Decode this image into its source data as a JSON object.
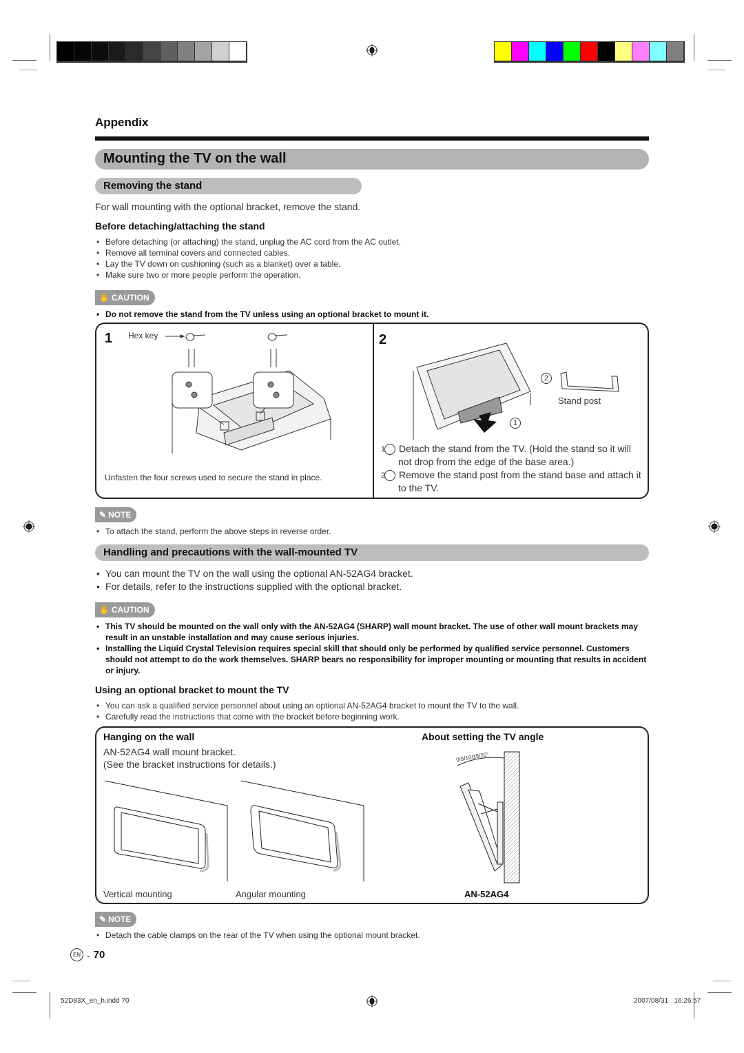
{
  "print_marks": {
    "grayscale_swatches": [
      "#000000",
      "#060606",
      "#0d0d0d",
      "#1a1a1a",
      "#2a2a2a",
      "#444444",
      "#606060",
      "#808080",
      "#a3a3a3",
      "#d0d0d0",
      "#ffffff"
    ],
    "color_swatches": [
      "#ffff00",
      "#ff00ff",
      "#00ffff",
      "#0000ff",
      "#00ff00",
      "#ff0000",
      "#000000",
      "#ffff80",
      "#ff80ff",
      "#80ffff",
      "#808080"
    ],
    "slug_file": "52D83X_en_h.indd  70",
    "slug_timestamp": "2007/08/31   16:26:57"
  },
  "header": {
    "section": "Appendix",
    "title": "Mounting the TV on the wall"
  },
  "removing": {
    "heading": "Removing the stand",
    "intro": "For wall mounting with the optional bracket, remove the stand.",
    "before_heading": "Before detaching/attaching the stand",
    "before_items": [
      "Before detaching (or attaching) the stand, unplug the AC cord from the AC outlet.",
      "Remove all terminal covers and connected cables.",
      "Lay the TV down on cushioning (such as a blanket) over a table.",
      "Make sure two or more people perform the operation."
    ],
    "caution_label": "CAUTION",
    "caution_items": [
      "Do not remove the stand from the TV unless using an optional bracket to mount it."
    ],
    "step1": {
      "number": "1",
      "hex_key_label": "Hex key",
      "caption": "Unfasten the four screws used to secure the stand in place."
    },
    "step2": {
      "number": "2",
      "callout_1": "1",
      "callout_2": "2",
      "stand_post_label": "Stand post",
      "instructions": [
        {
          "num": "1",
          "text": "Detach the stand from the TV. (Hold the stand so it will not drop from the edge of the base area.)"
        },
        {
          "num": "2",
          "text": "Remove the stand post from the stand base and attach it to the TV."
        }
      ]
    },
    "note_label": "NOTE",
    "note_items": [
      "To attach the stand, perform the above steps in reverse order."
    ]
  },
  "handling": {
    "heading": "Handling and precautions with the wall-mounted TV",
    "items": [
      "You can mount the TV on the wall using the optional AN-52AG4 bracket.",
      "For details, refer to the instructions supplied with the optional bracket."
    ],
    "caution_label": "CAUTION",
    "caution_items": [
      "This TV should be mounted on the wall only with the AN-52AG4 (SHARP) wall mount bracket. The use of other wall mount brackets may result in an unstable installation and may cause serious injuries.",
      "Installing the Liquid Crystal Television requires special skill that should only be performed by qualified service personnel. Customers should not attempt to do the work themselves. SHARP bears no responsibility for improper mounting or mounting that results in accident or injury."
    ],
    "bracket_heading": "Using an optional bracket to mount the TV",
    "bracket_items": [
      "You can ask a qualified service personnel about using an optional AN-52AG4 bracket to mount the TV to the wall.",
      "Carefully read the instructions that come with the bracket before beginning work."
    ],
    "hanging": {
      "heading": "Hanging on the wall",
      "line1": "AN-52AG4 wall mount bracket.",
      "line2": "(See the bracket instructions for details.)",
      "vertical_label": "Vertical mounting",
      "angular_label": "Angular mounting"
    },
    "angle": {
      "heading": "About setting the TV angle",
      "angles": "0/5/10/15/20°",
      "model": "AN-52AG4"
    },
    "note_label": "NOTE",
    "note_items": [
      "Detach the cable clamps on the rear of the TV when using the optional mount bracket."
    ]
  },
  "footer": {
    "lang": "EN",
    "page": "70"
  }
}
